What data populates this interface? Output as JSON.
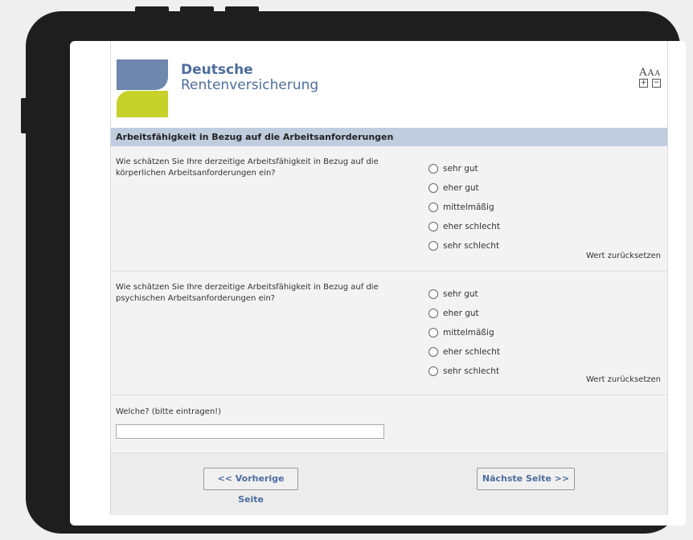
{
  "brand": {
    "line1": "Deutsche",
    "line2": "Rentenversicherung",
    "logo_colors": {
      "top": "#6d87ad",
      "bottom": "#c6d12a"
    }
  },
  "font_controls": {
    "sizes": [
      "A",
      "A",
      "A"
    ],
    "zoom_in_icon": "plus-box-icon",
    "zoom_out_icon": "minus-box-icon",
    "zoom_in": "+",
    "zoom_out": "−"
  },
  "section": {
    "title": "Arbeitsfähigkeit in Bezug auf die Arbeitsanforderungen"
  },
  "questions": [
    {
      "text": "Wie schätzen Sie Ihre derzeitige Arbeitsfähigkeit in Bezug auf die körperlichen Arbeitsanforderungen ein?",
      "options": [
        "sehr gut",
        "eher gut",
        "mittelmäßig",
        "eher schlecht",
        "sehr schlecht"
      ],
      "reset_label": "Wert zurücksetzen"
    },
    {
      "text": "Wie schätzen Sie Ihre derzeitige Arbeitsfähigkeit in Bezug auf die psychischen Arbeitsanforderungen ein?",
      "options": [
        "sehr gut",
        "eher gut",
        "mittelmäßig",
        "eher schlecht",
        "sehr schlecht"
      ],
      "reset_label": "Wert zurücksetzen"
    }
  ],
  "free_text": {
    "label": "Welche? (bitte eintragen!)",
    "value": ""
  },
  "navigation": {
    "prev_label": "<< Vorherige Seite",
    "next_label": "Nächste Seite >>"
  },
  "colors": {
    "header_band": "#bfcddf",
    "brand_text": "#4d6d9d",
    "device_frame": "#1e1e1e"
  }
}
